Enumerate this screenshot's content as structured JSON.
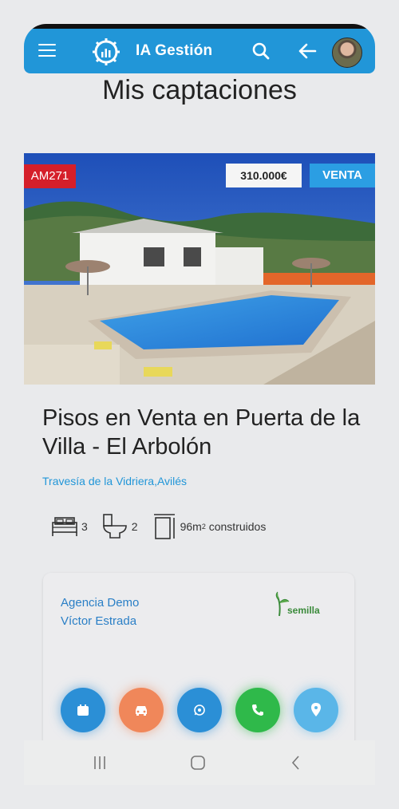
{
  "app": {
    "brand": "IA Gestión",
    "accent_color": "#2196d8",
    "icons": {
      "menu": "hamburger-icon",
      "logo": "gear-chart-logo",
      "search": "search-icon",
      "back": "arrow-left-icon",
      "avatar": "user-avatar"
    }
  },
  "page": {
    "title": "Mis captaciones"
  },
  "listing": {
    "reference": "AM271",
    "price": "310.000€",
    "operation": "VENTA",
    "title": "Pisos en Venta en Puerta de la Villa - El Arbolón",
    "address": "Travesía de la Vidriera,Avilés",
    "features": {
      "bedrooms": "3",
      "bathrooms": "2",
      "area_value": "96m",
      "area_exp": "2",
      "area_suffix": " construidos"
    }
  },
  "agent": {
    "agency": "Agencia Demo",
    "name": "Víctor Estrada",
    "partner_logo_text": "semilla"
  },
  "actions": [
    {
      "icon": "calendar-icon",
      "color": "#2b8fd6"
    },
    {
      "icon": "car-icon",
      "color": "#f0875a"
    },
    {
      "icon": "whatsapp-icon",
      "color": "#2b8fd6"
    },
    {
      "icon": "phone-icon",
      "color": "#2fb94a"
    },
    {
      "icon": "location-pin-icon",
      "color": "#5ab6e8"
    }
  ],
  "system_nav": {
    "icons": [
      "recents-icon",
      "home-icon",
      "back-icon"
    ]
  }
}
